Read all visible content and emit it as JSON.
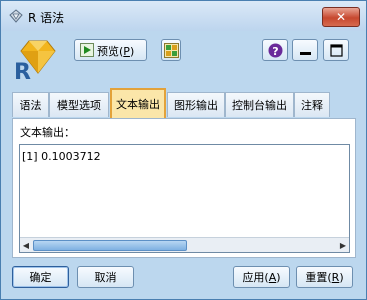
{
  "window": {
    "title": "R 语法",
    "close_label": "✕",
    "logo_icon": "diamond-logo-icon"
  },
  "toolbar": {
    "preview_label_prefix": "预览(",
    "preview_label_key": "P",
    "preview_label_suffix": ")",
    "app_logo_letter": "R",
    "help_label": "?"
  },
  "tabs": [
    {
      "label": "语法"
    },
    {
      "label": "模型选项"
    },
    {
      "label": "文本输出"
    },
    {
      "label": "图形输出"
    },
    {
      "label": "控制台输出"
    },
    {
      "label": "注释"
    }
  ],
  "active_tab_index": 2,
  "panel": {
    "label": "文本输出：",
    "output": "[1] 0.1003712"
  },
  "buttons": {
    "ok": "确定",
    "cancel": "取消",
    "apply_prefix": "应用(",
    "apply_key": "A",
    "apply_suffix": ")",
    "reset_prefix": "重置(",
    "reset_key": "R",
    "reset_suffix": ")"
  },
  "colors": {
    "frame": "#bcd7ee",
    "active_tab": "#fbe6a9",
    "close_button": "#c7482f",
    "logo_gold": "#f2b51d",
    "logo_r": "#2a5f9e"
  }
}
